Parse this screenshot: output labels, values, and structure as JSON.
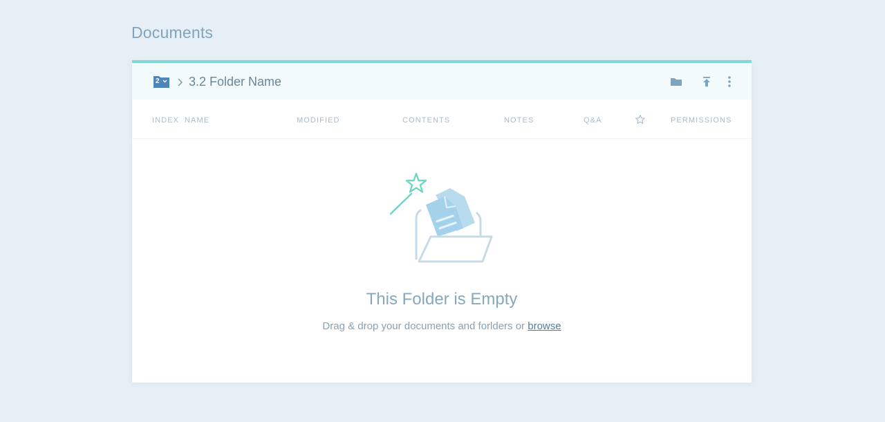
{
  "page": {
    "title": "Documents"
  },
  "toolbar": {
    "folder_badge_count": "2",
    "breadcrumb_label": "3.2 Folder Name",
    "icons": [
      "folder-icon",
      "upload-icon",
      "more-vertical-icon"
    ]
  },
  "table": {
    "columns": {
      "index": "INDEX",
      "name": "NAME",
      "modified": "MODIFIED",
      "contents": "CONTENTS",
      "notes": "NOTES",
      "qa": "Q&A",
      "permissions": "PERMISSIONS"
    },
    "star_icon": "star-icon"
  },
  "empty_state": {
    "title": "This Folder is Empty",
    "subtitle": "Drag & drop your documents and forlders or ",
    "browse_label": "browse"
  },
  "colors": {
    "background": "#e6eff6",
    "accent_top_border": "#7fd8d6",
    "folder_badge": "#4f86b8",
    "illustration_wand": "#6fd6c4",
    "illustration_doc": "#a9d4ea"
  }
}
